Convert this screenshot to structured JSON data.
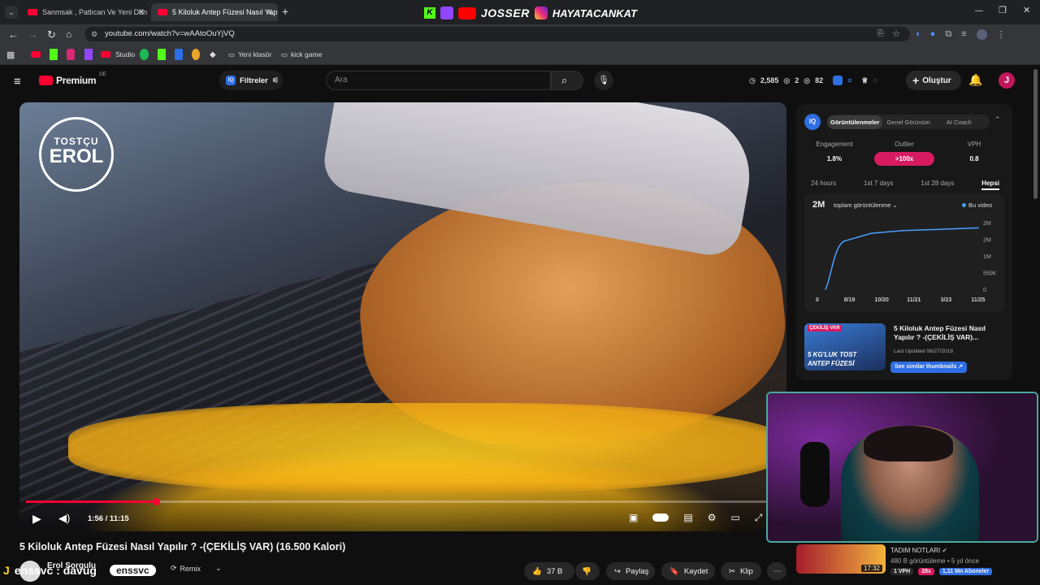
{
  "browser": {
    "tabs": [
      {
        "label": "Sanmsak , Patlıcan Ve Yeni Dün"
      },
      {
        "label": "5 Kiloluk Antep Füzesi Nasıl Yap"
      }
    ],
    "url": "youtube.com/watch?v=wAAtoOuYjVQ",
    "bookmarks": {
      "studio": "Studio",
      "folder1": "Yeni klasör",
      "folder2": "kick game"
    },
    "stream_banner": {
      "name1": "JOSSER",
      "name2": "HAYATACANKAT"
    }
  },
  "yt": {
    "logo": "Premium",
    "region": "DE",
    "filter_label": "Filtreler",
    "search_placeholder": "Ara",
    "stats": {
      "views": "2,585",
      "comments": "2",
      "likes": "82"
    },
    "create_label": "Oluştur",
    "avatar_letter": "J"
  },
  "video": {
    "title": "5 Kiloluk Antep Füzesi Nasıl Yapılır ? -(ÇEKİLİŞ VAR) (16.500 Kalori)",
    "time": "1:56 / 11:15",
    "progress": 0.172,
    "brand_top": "TOSTÇU",
    "brand_name": "EROL",
    "channel": "Erol Sorgulu",
    "likes": "37 B",
    "share": "Paylaş",
    "save": "Kaydet",
    "clip": "Klip",
    "remix": "Remix"
  },
  "panel": {
    "tabs": [
      "Görüntülenmeler",
      "Genel Görünüm",
      "AI Coach"
    ],
    "metrics": [
      {
        "label": "Engagement",
        "value": "1.8%"
      },
      {
        "label": "Outlier",
        "value": ">100x"
      },
      {
        "label": "VPH",
        "value": "0.8"
      }
    ],
    "ranges": [
      "24 hours",
      "1st 7 days",
      "1st 28 days",
      "Hepsi"
    ],
    "total": "2M",
    "total_label": "toplam görüntülenme",
    "legend": "Bu video",
    "thumb_title": "5 Kiloluk Antep Füzesi Nasıl Yapılır ? -(ÇEKİLİŞ VAR)...",
    "last_updated": "Last Updated 06/27/2018",
    "similar_btn": "See similar thumbnails",
    "thumb_text1": "ÇEKİLİŞ VAR",
    "thumb_text2": "5 KG'LUK TOST",
    "thumb_text3": "ANTEP FÜZESİ"
  },
  "chart_data": {
    "type": "line",
    "x": [
      "0",
      "8/19",
      "10/20",
      "11/21",
      "3/23",
      "11/25"
    ],
    "y_ticks": [
      "2M",
      "2M",
      "1M",
      "550K",
      "0"
    ],
    "series": [
      {
        "name": "Bu video",
        "values": [
          0,
          1800000,
          2100000,
          2200000,
          2250000,
          2300000
        ]
      }
    ]
  },
  "sidebar_video": {
    "channel": "TADIM NOTLARI",
    "meta": "480 B görüntüleme • 5 yıl önce",
    "duration": "17:32",
    "vph": "1 VPH",
    "outlier": "28x",
    "subs": "1,11 Mn Aboneler"
  },
  "overlay": {
    "chat": "enssvc : davug",
    "badge": "enssvc"
  }
}
